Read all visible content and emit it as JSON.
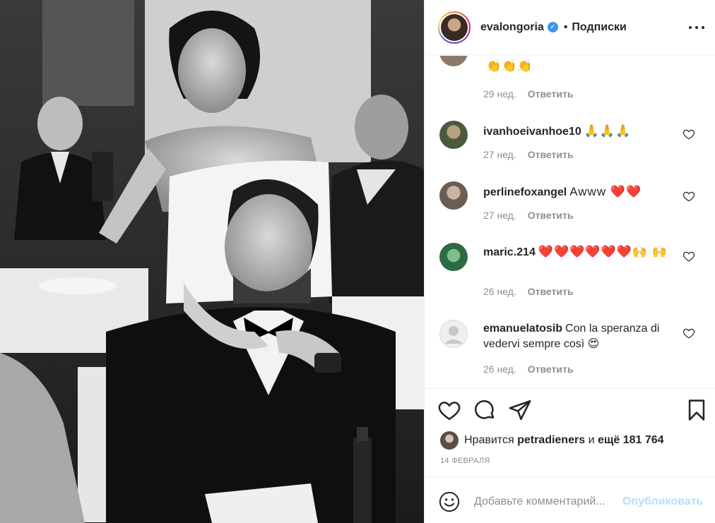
{
  "post": {
    "username": "evalongoria",
    "verified_mark": "✓",
    "separator": "•",
    "follow_label": "Подписки",
    "more_icon": "more-horizontal-icon"
  },
  "comments": [
    {
      "user": "",
      "text": "👏👏👏",
      "time": "29 нед.",
      "reply": "Ответить",
      "avatar_color": "#8a7a6a"
    },
    {
      "user": "ivanhoeivanhoe10",
      "text": "🙏🙏🙏",
      "time": "27 нед.",
      "reply": "Ответить",
      "avatar_color": "#4a5a3e"
    },
    {
      "user": "perlinefoxangel",
      "text": "Awww ❤️❤️",
      "time": "27 нед.",
      "reply": "Ответить",
      "avatar_color": "#6b5d52"
    },
    {
      "user": "maric.214",
      "text": "❤️❤️❤️❤️❤️❤️🙌 🙌",
      "time": "26 нед.",
      "reply": "Ответить",
      "avatar_color": "#3f7a55"
    },
    {
      "user": "emanuelatosib",
      "text": "Con la speranza di vedervi sempre così 😍",
      "time": "26 нед.",
      "reply": "Ответить",
      "avatar_color": "#dbdbdb"
    }
  ],
  "actions": {
    "like_icon": "heart-icon",
    "comment_icon": "comment-icon",
    "share_icon": "paper-plane-icon",
    "save_icon": "bookmark-icon"
  },
  "likes": {
    "prefix": "Нравится",
    "user": "petradieners",
    "middle": "и",
    "count_text": "ещё 181 764"
  },
  "date": "14 ФЕВРАЛЯ",
  "add_comment": {
    "placeholder": "Добавьте комментарий...",
    "publish_label": "Опубликовать",
    "emoji_icon": "smiley-icon"
  },
  "colors": {
    "link_disabled": "#b2dffc",
    "verified": "#3897f0",
    "muted": "#8e8e8e",
    "heart_red": "#ed4956"
  }
}
